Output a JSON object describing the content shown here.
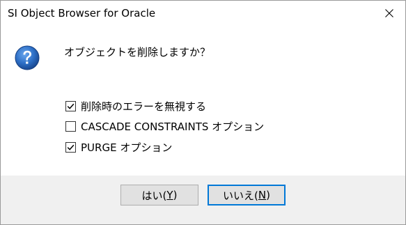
{
  "window": {
    "title": "SI Object Browser for Oracle",
    "close_glyph": "close-icon"
  },
  "dialog": {
    "icon": "question-icon",
    "message": "オブジェクトを削除しますか？",
    "options": [
      {
        "label": "削除時のエラーを無視する",
        "checked": true
      },
      {
        "label": "CASCADE CONSTRAINTS オプション",
        "checked": false
      },
      {
        "label": "PURGE オプション",
        "checked": true
      }
    ],
    "buttons": {
      "yes": {
        "prefix": "はい(",
        "accel": "Y",
        "suffix": ")"
      },
      "no": {
        "prefix": "いいえ(",
        "accel": "N",
        "suffix": ")",
        "default": true
      }
    }
  },
  "colors": {
    "footer_bg": "#f0f0f0",
    "default_button_border": "#0078d7",
    "icon_blue": "#1f5fb4"
  }
}
